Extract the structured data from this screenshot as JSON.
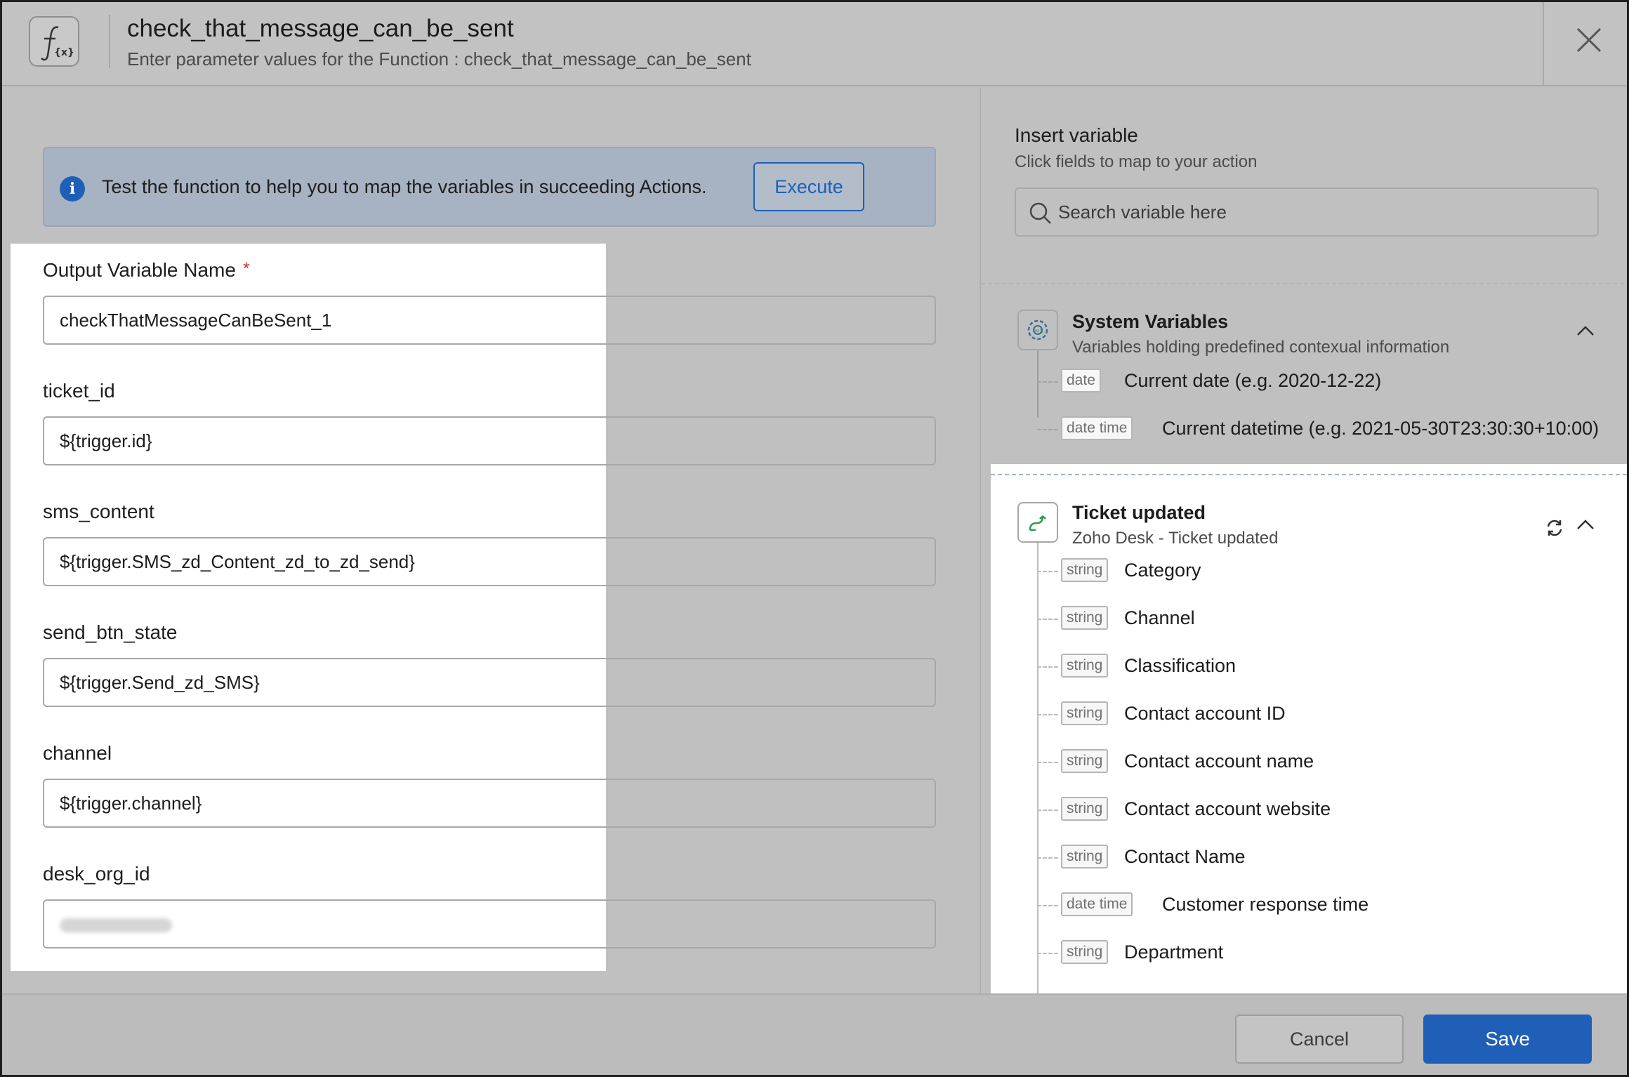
{
  "header": {
    "title": "check_that_message_can_be_sent",
    "subtitle": "Enter parameter values for the Function : check_that_message_can_be_sent"
  },
  "banner": {
    "text": "Test the function to help you to map the variables in succeeding Actions.",
    "execute_label": "Execute"
  },
  "form": {
    "fields": [
      {
        "label": "Output Variable Name",
        "required": true,
        "value": "checkThatMessageCanBeSent_1"
      },
      {
        "label": "ticket_id",
        "value": "${trigger.id}"
      },
      {
        "label": "sms_content",
        "value": "${trigger.SMS_zd_Content_zd_to_zd_send}"
      },
      {
        "label": "send_btn_state",
        "value": "${trigger.Send_zd_SMS}"
      },
      {
        "label": "channel",
        "value": "${trigger.channel}"
      },
      {
        "label": "desk_org_id",
        "value": ""
      }
    ],
    "required_marker": "*"
  },
  "insert_variable": {
    "title": "Insert variable",
    "subtitle": "Click fields to map to your action",
    "search_placeholder": "Search variable here"
  },
  "system_variables": {
    "title": "System Variables",
    "subtitle": "Variables holding predefined contexual information",
    "items": [
      {
        "type": "date",
        "name": "Current date (e.g. 2020-12-22)"
      },
      {
        "type": "date time",
        "name": "Current datetime (e.g. 2021-05-30T23:30:30+10:00)"
      }
    ]
  },
  "ticket_updated": {
    "title": "Ticket updated",
    "subtitle": "Zoho Desk - Ticket updated",
    "items": [
      {
        "type": "string",
        "name": "Category"
      },
      {
        "type": "string",
        "name": "Channel"
      },
      {
        "type": "string",
        "name": "Classification"
      },
      {
        "type": "string",
        "name": "Contact account ID"
      },
      {
        "type": "string",
        "name": "Contact account name"
      },
      {
        "type": "string",
        "name": "Contact account website"
      },
      {
        "type": "string",
        "name": "Contact Name"
      },
      {
        "type": "date time",
        "name": "Customer response time"
      },
      {
        "type": "string",
        "name": "Department"
      }
    ]
  },
  "footer": {
    "cancel_label": "Cancel",
    "save_label": "Save"
  },
  "colors": {
    "accent": "#1f5fb8",
    "required": "#d32626",
    "overlay": "#c0c0c0",
    "highlight": "#ffffff"
  },
  "icons": [
    "function-icon",
    "close-icon",
    "info-icon",
    "search-icon",
    "gear-variable-icon",
    "zoho-desk-icon",
    "refresh-icon",
    "chevron-up-icon"
  ]
}
